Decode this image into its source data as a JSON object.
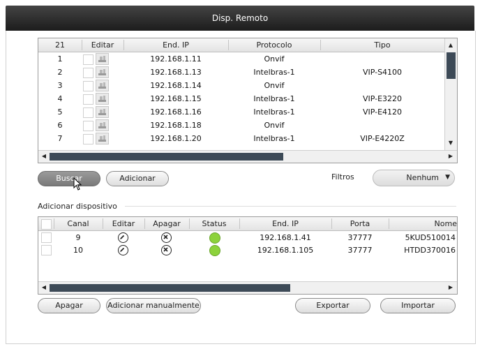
{
  "window": {
    "title": "Disp. Remoto"
  },
  "remote_table": {
    "headers": [
      "21",
      "Editar",
      "End. IP",
      "Protocolo",
      "Tipo"
    ],
    "rows": [
      {
        "num": "1",
        "ip": "192.168.1.11",
        "protocol": "Onvif",
        "type": ""
      },
      {
        "num": "2",
        "ip": "192.168.1.13",
        "protocol": "Intelbras-1",
        "type": "VIP-S4100"
      },
      {
        "num": "3",
        "ip": "192.168.1.14",
        "protocol": "Onvif",
        "type": ""
      },
      {
        "num": "4",
        "ip": "192.168.1.15",
        "protocol": "Intelbras-1",
        "type": "VIP-E3220"
      },
      {
        "num": "5",
        "ip": "192.168.1.16",
        "protocol": "Intelbras-1",
        "type": "VIP-E4120"
      },
      {
        "num": "6",
        "ip": "192.168.1.18",
        "protocol": "Onvif",
        "type": ""
      },
      {
        "num": "7",
        "ip": "192.168.1.20",
        "protocol": "Intelbras-1",
        "type": "VIP-E4220Z"
      }
    ]
  },
  "actions": {
    "search": "Buscar",
    "add": "Adicionar"
  },
  "filters": {
    "label": "Filtros",
    "value": "Nenhum"
  },
  "added_section": {
    "title": "Adicionar dispositivo",
    "headers": [
      "Canal",
      "Editar",
      "Apagar",
      "Status",
      "End. IP",
      "Porta",
      "Nome"
    ],
    "rows": [
      {
        "channel": "9",
        "ip": "192.168.1.41",
        "port": "37777",
        "name": "5KUD510014"
      },
      {
        "channel": "10",
        "ip": "192.168.1.105",
        "port": "37777",
        "name": "HTDD370016"
      }
    ]
  },
  "bottom_buttons": {
    "delete": "Apagar",
    "add_manual": "Adicionar manualmente",
    "export": "Exportar",
    "import": "Importar"
  },
  "colors": {
    "status_online": "#8cd23b",
    "titlebar": "#2a2a2a",
    "scroll_thumb": "#3d4a57"
  }
}
